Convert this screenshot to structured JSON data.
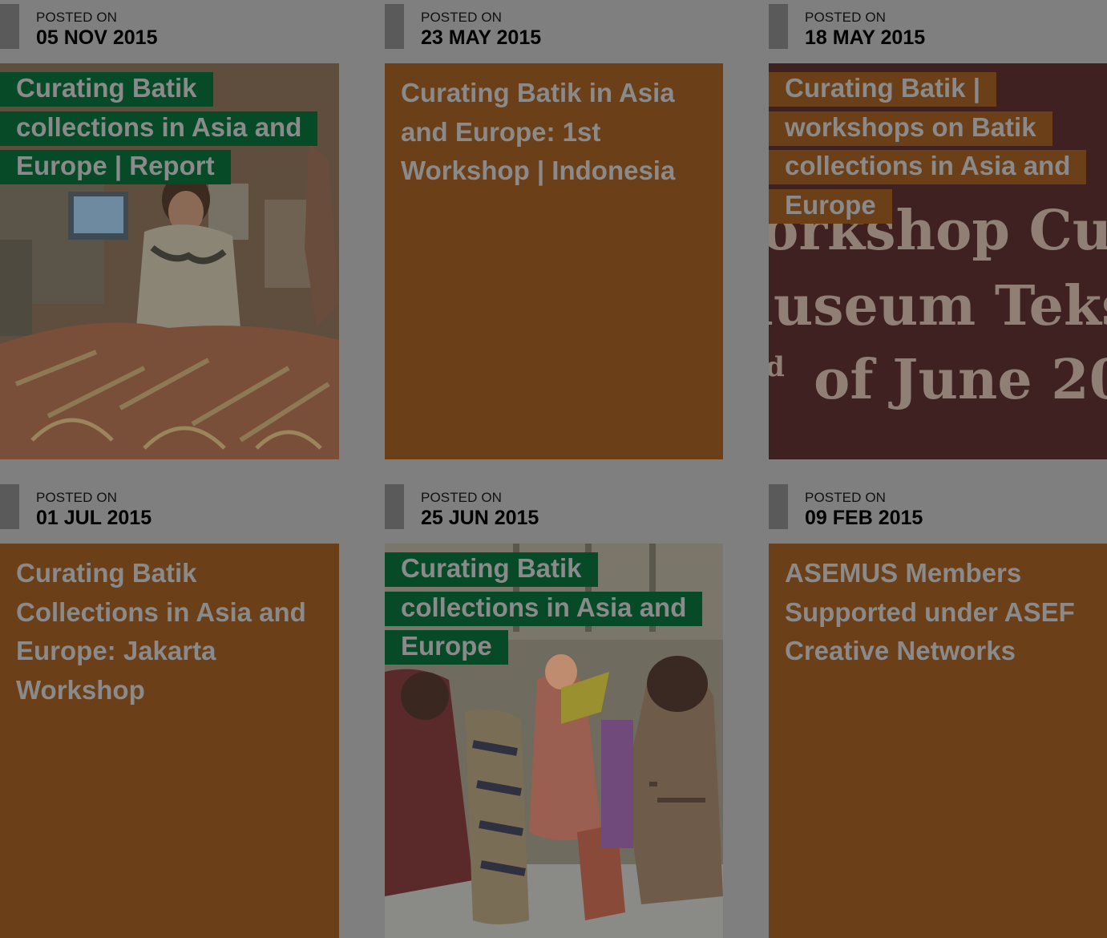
{
  "posts": [
    {
      "posted_label": "POSTED ON",
      "date": "05 NOV 2015",
      "title": "Curating Batik collections in Asia and Europe | Report",
      "image": "batik-office-photo",
      "style": "green-highlight"
    },
    {
      "posted_label": "POSTED ON",
      "date": "23 MAY 2015",
      "title": "Curating Batik in Asia and Europe: 1st Workshop | Indonesia",
      "image": null,
      "style": "solid-brown"
    },
    {
      "posted_label": "POSTED ON",
      "date": "18 MAY 2015",
      "title": "Curating Batik | workshops on Batik collections in Asia and Europe",
      "image": "workshop-banner-photo",
      "style": "orange-highlight"
    },
    {
      "posted_label": "POSTED ON",
      "date": "01 JUL 2015",
      "title": "Curating Batik Collections in Asia and Europe: Jakarta Workshop",
      "image": null,
      "style": "solid-brown"
    },
    {
      "posted_label": "POSTED ON",
      "date": "25 JUN 2015",
      "title": "Curating Batik collections in Asia and Europe",
      "image": "batik-group-photo",
      "style": "green-highlight"
    },
    {
      "posted_label": "POSTED ON",
      "date": "09 FEB 2015",
      "title": "ASEMUS Members Supported under ASEF Creative Networks",
      "image": null,
      "style": "solid-brown"
    }
  ],
  "banner_text": {
    "line1": "orkshop Cu",
    "line2": "luseum Teks",
    "line3_sup": "d",
    "line3": "of June 20"
  },
  "colors": {
    "background": "#7f7f7f",
    "brown": "#6b3f18",
    "green": "#064a28",
    "title_text": "#8a8a8a"
  }
}
